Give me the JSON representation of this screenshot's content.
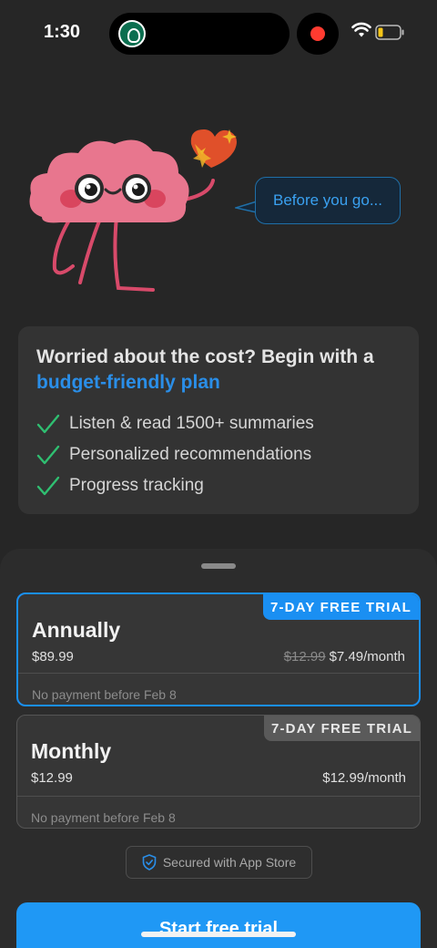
{
  "status_bar": {
    "time": "1:30"
  },
  "hero": {
    "speech_text": "Before you go..."
  },
  "info_card": {
    "title_part1": "Worried about the cost? Begin with a ",
    "title_accent": "budget-friendly plan",
    "benefits": [
      "Listen & read 1500+ summaries",
      "Personalized recommendations",
      "Progress tracking"
    ]
  },
  "plans": [
    {
      "name": "Annually",
      "price": "$89.99",
      "original_monthly": "$12.99",
      "monthly": "$7.49/month",
      "badge": "7-DAY FREE TRIAL",
      "note": "No payment before Feb 8",
      "selected": true
    },
    {
      "name": "Monthly",
      "price": "$12.99",
      "monthly": "$12.99/month",
      "badge": "7-DAY FREE TRIAL",
      "note": "No payment before Feb 8",
      "selected": false
    }
  ],
  "secured_label": "Secured with App Store",
  "cta_label": "Start free trial",
  "colors": {
    "accent": "#1f98f5",
    "check": "#2fbf71",
    "background": "#262626"
  },
  "icons": [
    "starbucks-app-icon",
    "record-icon",
    "wifi-icon",
    "battery-icon",
    "checkmark-icon",
    "shield-check-icon"
  ]
}
